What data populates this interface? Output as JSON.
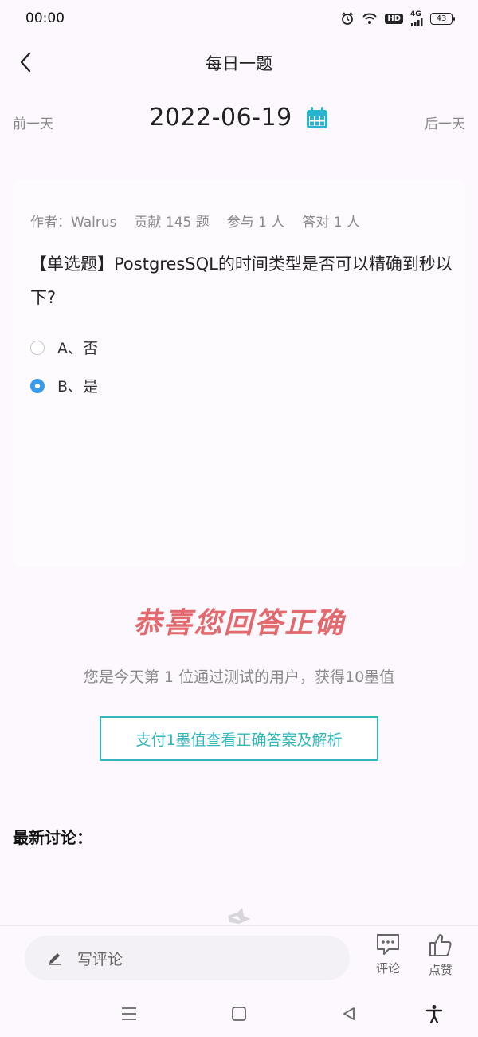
{
  "status_bar": {
    "time": "00:00",
    "battery": "43",
    "hd_label": "HD",
    "network_label": "4G"
  },
  "header": {
    "title": "每日一题"
  },
  "date_nav": {
    "prev_label": "前一天",
    "date": "2022-06-19",
    "next_label": "后一天"
  },
  "question": {
    "meta": {
      "author": "作者：Walrus",
      "contributed": "贡献 145 题",
      "participants": "参与 1 人",
      "correct_count": "答对 1 人"
    },
    "text": "【单选题】PostgresSQL的时间类型是否可以精确到秒以下?",
    "options": [
      {
        "label": "A、否",
        "selected": false
      },
      {
        "label": "B、是",
        "selected": true
      }
    ]
  },
  "result": {
    "title": "恭喜您回答正确",
    "subtitle": "您是今天第 1 位通过测试的用户，获得10墨值",
    "pay_button": "支付1墨值查看正确答案及解析"
  },
  "discussion": {
    "title": "最新讨论："
  },
  "bottom_bar": {
    "comment_placeholder": "写评论",
    "comment_label": "评论",
    "like_label": "点赞"
  },
  "colors": {
    "accent_teal": "#32b6bb",
    "correct_red": "#e26a6e",
    "radio_blue": "#3a9bea",
    "calendar_teal": "#29b3d0"
  }
}
